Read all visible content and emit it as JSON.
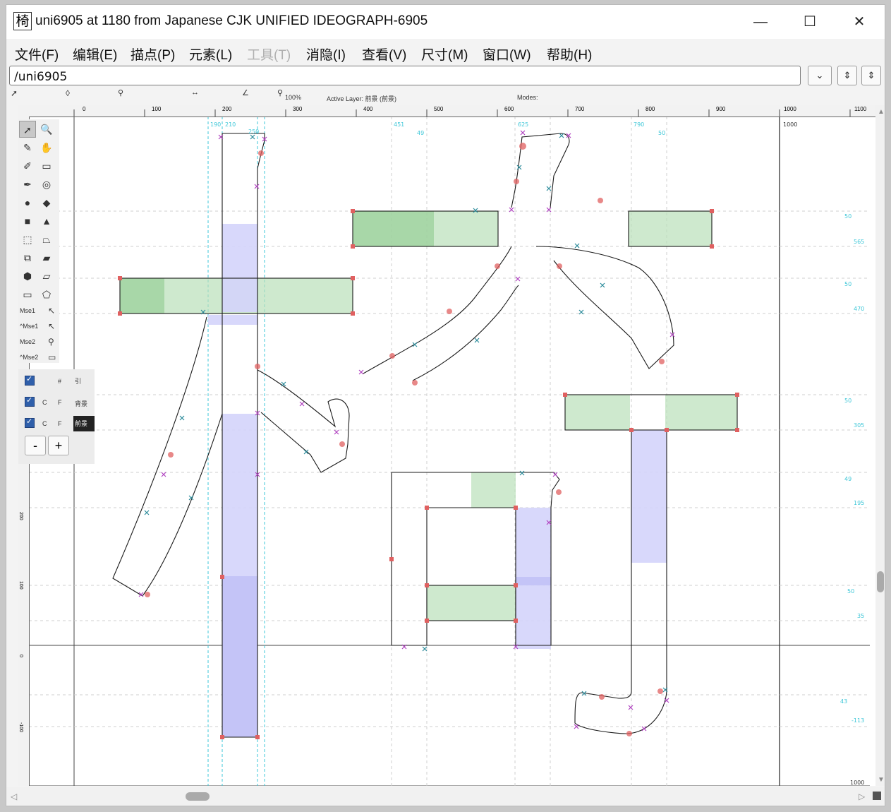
{
  "window": {
    "glyph_char": "椅",
    "title": "uni6905 at 1180 from Japanese CJK UNIFIED IDEOGRAPH-6905",
    "controls": {
      "minimize": "—",
      "maximize": "☐",
      "close": "✕"
    }
  },
  "menu": [
    {
      "label": "文件(F)",
      "enabled": true
    },
    {
      "label": "编辑(E)",
      "enabled": true
    },
    {
      "label": "描点(P)",
      "enabled": true
    },
    {
      "label": "元素(L)",
      "enabled": true
    },
    {
      "label": "工具(T)",
      "enabled": false
    },
    {
      "label": "消隐(I)",
      "enabled": true
    },
    {
      "label": "查看(V)",
      "enabled": true
    },
    {
      "label": "尺寸(M)",
      "enabled": true
    },
    {
      "label": "窗口(W)",
      "enabled": true
    },
    {
      "label": "帮助(H)",
      "enabled": true
    }
  ],
  "address": {
    "value": "/uni6905",
    "dropdown": "⌄",
    "btn1": "⇕",
    "btn2": "⇕"
  },
  "infobar": {
    "zoom": "100%",
    "active_layer": "Active Layer: 前景 (前景)",
    "modes": "Modes:"
  },
  "ruler": {
    "h_ticks": [
      "0",
      "100",
      "200",
      "300",
      "400",
      "500",
      "600",
      "700",
      "800",
      "900",
      "1000",
      "1100"
    ],
    "v_ticks": [
      "700",
      "600",
      "500",
      "400",
      "300",
      "200",
      "100",
      "0",
      "-100"
    ]
  },
  "guides": {
    "top_labels": [
      "190",
      "210",
      "250",
      "451",
      "625",
      "790"
    ],
    "widths": [
      "49",
      "50"
    ],
    "right_dims": [
      "50",
      "565",
      "50",
      "470",
      "50",
      "305",
      "49",
      "195",
      "50",
      "35",
      "43",
      "-113"
    ],
    "advance": "1000",
    "bottom_advance": "1000"
  },
  "toolbox": {
    "mse": [
      "Mse1",
      "^Mse1",
      "Mse2",
      "^Mse2"
    ]
  },
  "layers": [
    {
      "c": "",
      "f": "",
      "name": "引",
      "sym": "#"
    },
    {
      "c": "C",
      "f": "F",
      "name": "背景"
    },
    {
      "c": "C",
      "f": "F",
      "name": "前景",
      "active": true
    }
  ],
  "layer_buttons": {
    "minus": "-",
    "plus": "+"
  },
  "colors": {
    "stem_fill": "#d9d9fb",
    "hint_fill": "#b9dfb9",
    "guide": "#3ec7d8",
    "outline": "#222222"
  }
}
